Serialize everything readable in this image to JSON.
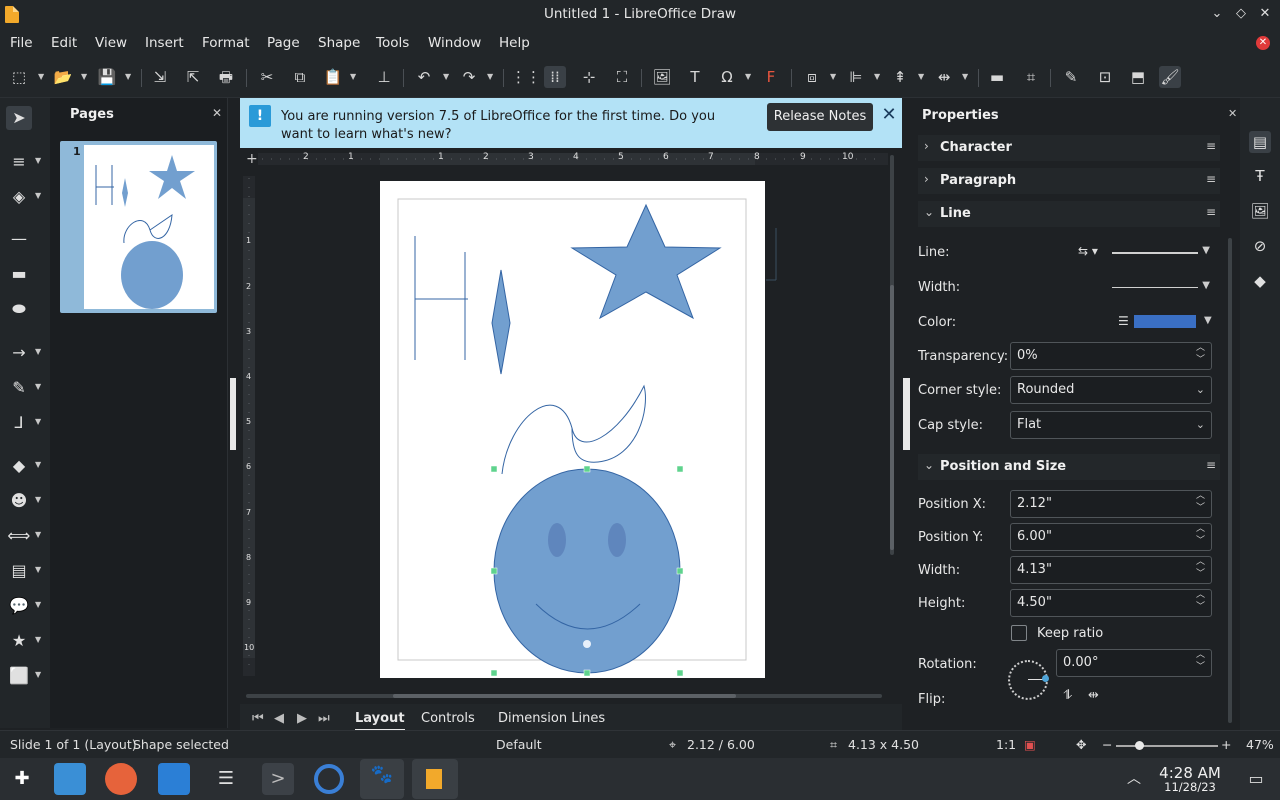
{
  "window": {
    "title": "Untitled 1 - LibreOffice Draw"
  },
  "menu": [
    "File",
    "Edit",
    "View",
    "Insert",
    "Format",
    "Page",
    "Shape",
    "Tools",
    "Window",
    "Help"
  ],
  "pages_panel": {
    "title": "Pages",
    "page_number": "1"
  },
  "infobar": {
    "message": "You are running version 7.5 of LibreOffice for the first time. Do you want to learn what's new?",
    "button": "Release Notes"
  },
  "ruler": {
    "h_marks": [
      "2",
      "1",
      "1",
      "2",
      "3",
      "4",
      "5",
      "6",
      "7",
      "8",
      "9",
      "10"
    ],
    "v_marks": [
      "1",
      "2",
      "3",
      "4",
      "5",
      "6",
      "7",
      "8",
      "9",
      "10"
    ]
  },
  "tabs": [
    "Layout",
    "Controls",
    "Dimension Lines"
  ],
  "properties": {
    "title": "Properties",
    "sections": {
      "character": "Character",
      "paragraph": "Paragraph",
      "line": "Line",
      "position_size": "Position and Size"
    },
    "line": {
      "line_label": "Line:",
      "width_label": "Width:",
      "color_label": "Color:",
      "color_value": "#3a6fc4",
      "transparency_label": "Transparency:",
      "transparency_value": "0%",
      "corner_label": "Corner style:",
      "corner_value": "Rounded",
      "cap_label": "Cap style:",
      "cap_value": "Flat"
    },
    "position": {
      "x_label": "Position X:",
      "x_value": "2.12\"",
      "y_label": "Position Y:",
      "y_value": "6.00\"",
      "width_label": "Width:",
      "width_value": "4.13\"",
      "height_label": "Height:",
      "height_value": "4.50\"",
      "keep_ratio": "Keep ratio",
      "rotation_label": "Rotation:",
      "rotation_value": "0.00°",
      "flip_label": "Flip:"
    }
  },
  "status": {
    "slide": "Slide 1 of 1 (Layout)",
    "selection": "Shape selected",
    "style": "Default",
    "position": "2.12 / 6.00",
    "size": "4.13 x 4.50",
    "scale": "1:1",
    "zoom": "47%"
  },
  "clock": {
    "time": "4:28 AM",
    "date": "11/28/23"
  },
  "colors": {
    "shape_fill": "#729fcf",
    "shape_stroke": "#3465a4",
    "accent": "#2a9ad8"
  }
}
